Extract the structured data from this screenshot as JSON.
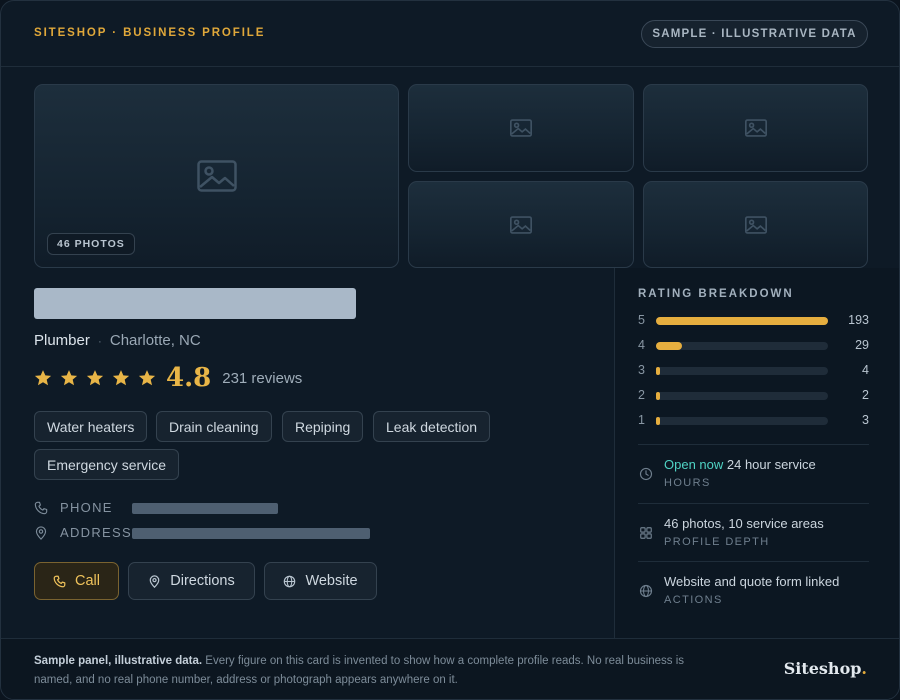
{
  "header": {
    "eyebrow": "SITESHOP · BUSINESS PROFILE",
    "badge": "SAMPLE · ILLUSTRATIVE DATA"
  },
  "gallery": {
    "photo_count_label": "46 PHOTOS",
    "icon": "image-placeholder-icon"
  },
  "business": {
    "category": "Plumber",
    "separator": "·",
    "location": "Charlotte, NC",
    "stars": 5,
    "rating": "4.8",
    "reviews": "231 reviews",
    "tags": [
      "Water heaters",
      "Drain cleaning",
      "Repiping",
      "Leak detection",
      "Emergency service"
    ]
  },
  "contact": {
    "phone_label": "PHONE",
    "address_label": "ADDRESS"
  },
  "actions": {
    "call": "Call",
    "directions": "Directions",
    "website": "Website"
  },
  "rating_breakdown": {
    "title": "RATING BREAKDOWN",
    "rows": [
      {
        "stars": "5",
        "count": "193",
        "fraction": 1.0
      },
      {
        "stars": "4",
        "count": "29",
        "fraction": 0.15
      },
      {
        "stars": "3",
        "count": "4",
        "fraction": 0.02
      },
      {
        "stars": "2",
        "count": "2",
        "fraction": 0.01
      },
      {
        "stars": "1",
        "count": "3",
        "fraction": 0.015
      }
    ]
  },
  "info": {
    "hours": {
      "status": "Open now",
      "detail": " 24 hour service",
      "label": "HOURS"
    },
    "depth": {
      "text": "46 photos, 10 service areas",
      "label": "PROFILE DEPTH"
    },
    "links": {
      "text": "Website and quote form linked",
      "label": "ACTIONS"
    }
  },
  "footer": {
    "lead": "Sample panel, illustrative data.",
    "body": " Every figure on this card is invented to show how a complete profile reads. No real business is named, and no real phone number, address or photograph appears anywhere on it.",
    "brand": "Siteshop",
    "brand_dot": "."
  },
  "colors": {
    "accent": "#e0a83a",
    "open": "#4fd3c4",
    "background": "#0e1a26"
  }
}
